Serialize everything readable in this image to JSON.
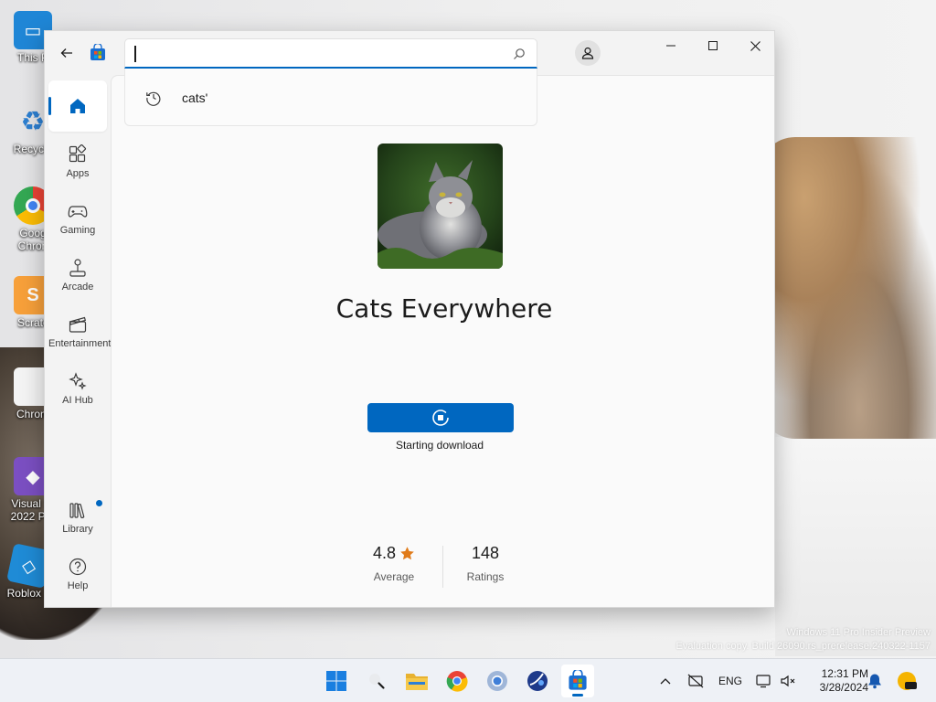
{
  "desktop": {
    "icons": [
      {
        "label": "This P",
        "color": "#1f86d6",
        "glyph": "▭"
      },
      {
        "label": "Recycle",
        "color": "#5a9bd5",
        "glyph": "♻"
      },
      {
        "label": "Goog Chron",
        "color": "#ea4335",
        "glyph": "●"
      },
      {
        "label": "Scratc",
        "color": "#f7a03a",
        "glyph": "S"
      },
      {
        "label": "Chrom",
        "color": "#e8e8e8",
        "glyph": ""
      },
      {
        "label": "Visual St 2022 Pre",
        "color": "#7b4fc2",
        "glyph": "◆"
      },
      {
        "label": "Roblox S",
        "color": "#1f8bd6",
        "glyph": "◇"
      }
    ],
    "watermark_line1": "Windows 11 Pro Insider Preview",
    "watermark_line2": "Evaluation copy. Build 26090.rs_prerelease.240322-1157"
  },
  "window": {
    "search": {
      "value": "",
      "placeholder": ""
    },
    "suggestion": "cats'",
    "nav": [
      {
        "id": "home",
        "label": "",
        "icon": "home-icon",
        "active": true
      },
      {
        "id": "apps",
        "label": "Apps",
        "icon": "apps-icon"
      },
      {
        "id": "gaming",
        "label": "Gaming",
        "icon": "gamepad-icon"
      },
      {
        "id": "arcade",
        "label": "Arcade",
        "icon": "joystick-icon"
      },
      {
        "id": "entertainment",
        "label": "Entertainment",
        "icon": "clapperboard-icon"
      },
      {
        "id": "ai-hub",
        "label": "AI Hub",
        "icon": "sparkle-icon"
      },
      {
        "id": "library",
        "label": "Library",
        "icon": "library-icon",
        "badge": true
      },
      {
        "id": "help",
        "label": "Help",
        "icon": "help-icon"
      }
    ],
    "app": {
      "title": "Cats Everywhere",
      "download_status": "Starting download",
      "rating": "4.8",
      "rating_caption": "Average",
      "ratings_count": "148",
      "ratings_caption": "Ratings"
    }
  },
  "taskbar": {
    "lang": "ENG",
    "time": "12:31 PM",
    "date": "3/28/2024",
    "apps": [
      "start-icon",
      "search-icon",
      "file-explorer-icon",
      "chrome-icon",
      "chrome-alt-icon",
      "browser-icon",
      "store-icon"
    ]
  },
  "colors": {
    "accent": "#0067c0",
    "star": "#e07b1a"
  }
}
